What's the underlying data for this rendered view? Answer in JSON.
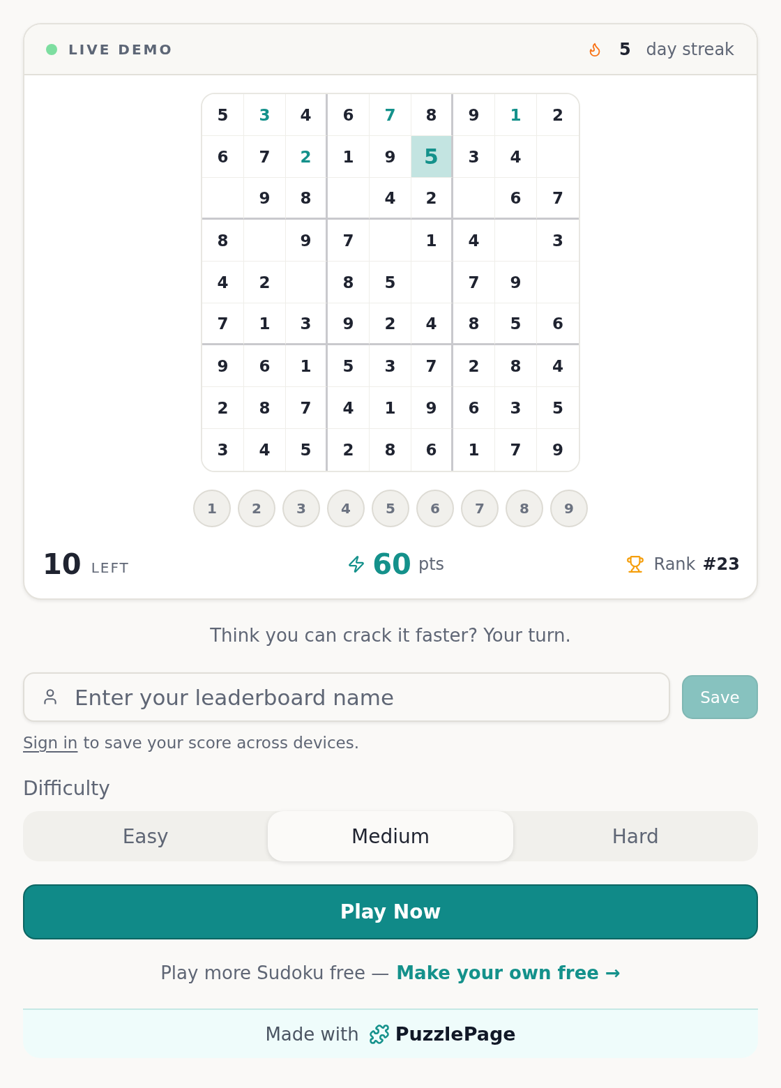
{
  "header": {
    "live_label": "LIVE DEMO",
    "streak_count": "5",
    "streak_label": "day streak"
  },
  "grid": {
    "rows": [
      [
        {
          "value": "5",
          "kind": "given",
          "selected": false
        },
        {
          "value": "3",
          "kind": "entered",
          "selected": false
        },
        {
          "value": "4",
          "kind": "given",
          "selected": false
        },
        {
          "value": "6",
          "kind": "given",
          "selected": false
        },
        {
          "value": "7",
          "kind": "entered",
          "selected": false
        },
        {
          "value": "8",
          "kind": "given",
          "selected": false
        },
        {
          "value": "9",
          "kind": "given",
          "selected": false
        },
        {
          "value": "1",
          "kind": "entered",
          "selected": false
        },
        {
          "value": "2",
          "kind": "given",
          "selected": false
        }
      ],
      [
        {
          "value": "6",
          "kind": "given",
          "selected": false
        },
        {
          "value": "7",
          "kind": "given",
          "selected": false
        },
        {
          "value": "2",
          "kind": "entered",
          "selected": false
        },
        {
          "value": "1",
          "kind": "given",
          "selected": false
        },
        {
          "value": "9",
          "kind": "given",
          "selected": false
        },
        {
          "value": "5",
          "kind": "entered",
          "selected": true
        },
        {
          "value": "3",
          "kind": "given",
          "selected": false
        },
        {
          "value": "4",
          "kind": "given",
          "selected": false
        },
        {
          "kind": "empty",
          "selected": false
        }
      ],
      [
        {
          "kind": "empty",
          "selected": false
        },
        {
          "value": "9",
          "kind": "given",
          "selected": false
        },
        {
          "value": "8",
          "kind": "given",
          "selected": false
        },
        {
          "kind": "empty",
          "selected": false
        },
        {
          "value": "4",
          "kind": "given",
          "selected": false
        },
        {
          "value": "2",
          "kind": "given",
          "selected": false
        },
        {
          "kind": "empty",
          "selected": false
        },
        {
          "value": "6",
          "kind": "given",
          "selected": false
        },
        {
          "value": "7",
          "kind": "given",
          "selected": false
        }
      ],
      [
        {
          "value": "8",
          "kind": "given",
          "selected": false
        },
        {
          "kind": "empty",
          "selected": false
        },
        {
          "value": "9",
          "kind": "given",
          "selected": false
        },
        {
          "value": "7",
          "kind": "given",
          "selected": false
        },
        {
          "kind": "empty",
          "selected": false
        },
        {
          "value": "1",
          "kind": "given",
          "selected": false
        },
        {
          "value": "4",
          "kind": "given",
          "selected": false
        },
        {
          "kind": "empty",
          "selected": false
        },
        {
          "value": "3",
          "kind": "given",
          "selected": false
        }
      ],
      [
        {
          "value": "4",
          "kind": "given",
          "selected": false
        },
        {
          "value": "2",
          "kind": "given",
          "selected": false
        },
        {
          "kind": "empty",
          "selected": false
        },
        {
          "value": "8",
          "kind": "given",
          "selected": false
        },
        {
          "value": "5",
          "kind": "given",
          "selected": false
        },
        {
          "kind": "empty",
          "selected": false
        },
        {
          "value": "7",
          "kind": "given",
          "selected": false
        },
        {
          "value": "9",
          "kind": "given",
          "selected": false
        },
        {
          "kind": "empty",
          "selected": false
        }
      ],
      [
        {
          "value": "7",
          "kind": "given",
          "selected": false
        },
        {
          "value": "1",
          "kind": "given",
          "selected": false
        },
        {
          "value": "3",
          "kind": "given",
          "selected": false
        },
        {
          "value": "9",
          "kind": "given",
          "selected": false
        },
        {
          "value": "2",
          "kind": "given",
          "selected": false
        },
        {
          "value": "4",
          "kind": "given",
          "selected": false
        },
        {
          "value": "8",
          "kind": "given",
          "selected": false
        },
        {
          "value": "5",
          "kind": "given",
          "selected": false
        },
        {
          "value": "6",
          "kind": "given",
          "selected": false
        }
      ],
      [
        {
          "value": "9",
          "kind": "given",
          "selected": false
        },
        {
          "value": "6",
          "kind": "given",
          "selected": false
        },
        {
          "value": "1",
          "kind": "given",
          "selected": false
        },
        {
          "value": "5",
          "kind": "given",
          "selected": false
        },
        {
          "value": "3",
          "kind": "given",
          "selected": false
        },
        {
          "value": "7",
          "kind": "given",
          "selected": false
        },
        {
          "value": "2",
          "kind": "given",
          "selected": false
        },
        {
          "value": "8",
          "kind": "given",
          "selected": false
        },
        {
          "value": "4",
          "kind": "given",
          "selected": false
        }
      ],
      [
        {
          "value": "2",
          "kind": "given",
          "selected": false
        },
        {
          "value": "8",
          "kind": "given",
          "selected": false
        },
        {
          "value": "7",
          "kind": "given",
          "selected": false
        },
        {
          "value": "4",
          "kind": "given",
          "selected": false
        },
        {
          "value": "1",
          "kind": "given",
          "selected": false
        },
        {
          "value": "9",
          "kind": "given",
          "selected": false
        },
        {
          "value": "6",
          "kind": "given",
          "selected": false
        },
        {
          "value": "3",
          "kind": "given",
          "selected": false
        },
        {
          "value": "5",
          "kind": "given",
          "selected": false
        }
      ],
      [
        {
          "value": "3",
          "kind": "given",
          "selected": false
        },
        {
          "value": "4",
          "kind": "given",
          "selected": false
        },
        {
          "value": "5",
          "kind": "given",
          "selected": false
        },
        {
          "value": "2",
          "kind": "given",
          "selected": false
        },
        {
          "value": "8",
          "kind": "given",
          "selected": false
        },
        {
          "value": "6",
          "kind": "given",
          "selected": false
        },
        {
          "value": "1",
          "kind": "given",
          "selected": false
        },
        {
          "value": "7",
          "kind": "given",
          "selected": false
        },
        {
          "value": "9",
          "kind": "given",
          "selected": false
        }
      ]
    ]
  },
  "number_pad": [
    "1",
    "2",
    "3",
    "4",
    "5",
    "6",
    "7",
    "8",
    "9"
  ],
  "stats": {
    "left_count": "10",
    "left_label": "LEFT",
    "points": "60",
    "points_unit": "pts",
    "rank_label": "Rank",
    "rank_value": "#23"
  },
  "prompt": "Think you can crack it faster? Your turn.",
  "name_field": {
    "placeholder": "Enter your leaderboard name"
  },
  "save_button": {
    "label": "Save",
    "disabled": true
  },
  "sign_in_note": {
    "link": "Sign in",
    "text": "to save your score across devices."
  },
  "difficulty": {
    "label": "Difficulty",
    "options": [
      {
        "label": "Easy",
        "selected": false
      },
      {
        "label": "Medium",
        "selected": true
      },
      {
        "label": "Hard",
        "selected": false
      }
    ]
  },
  "play_button": {
    "label": "Play Now"
  },
  "more_line": {
    "text": "Play more Sudoku free —",
    "link": "Make your own free →"
  },
  "footer": {
    "prefix": "Made with",
    "brand": "PuzzlePage"
  }
}
